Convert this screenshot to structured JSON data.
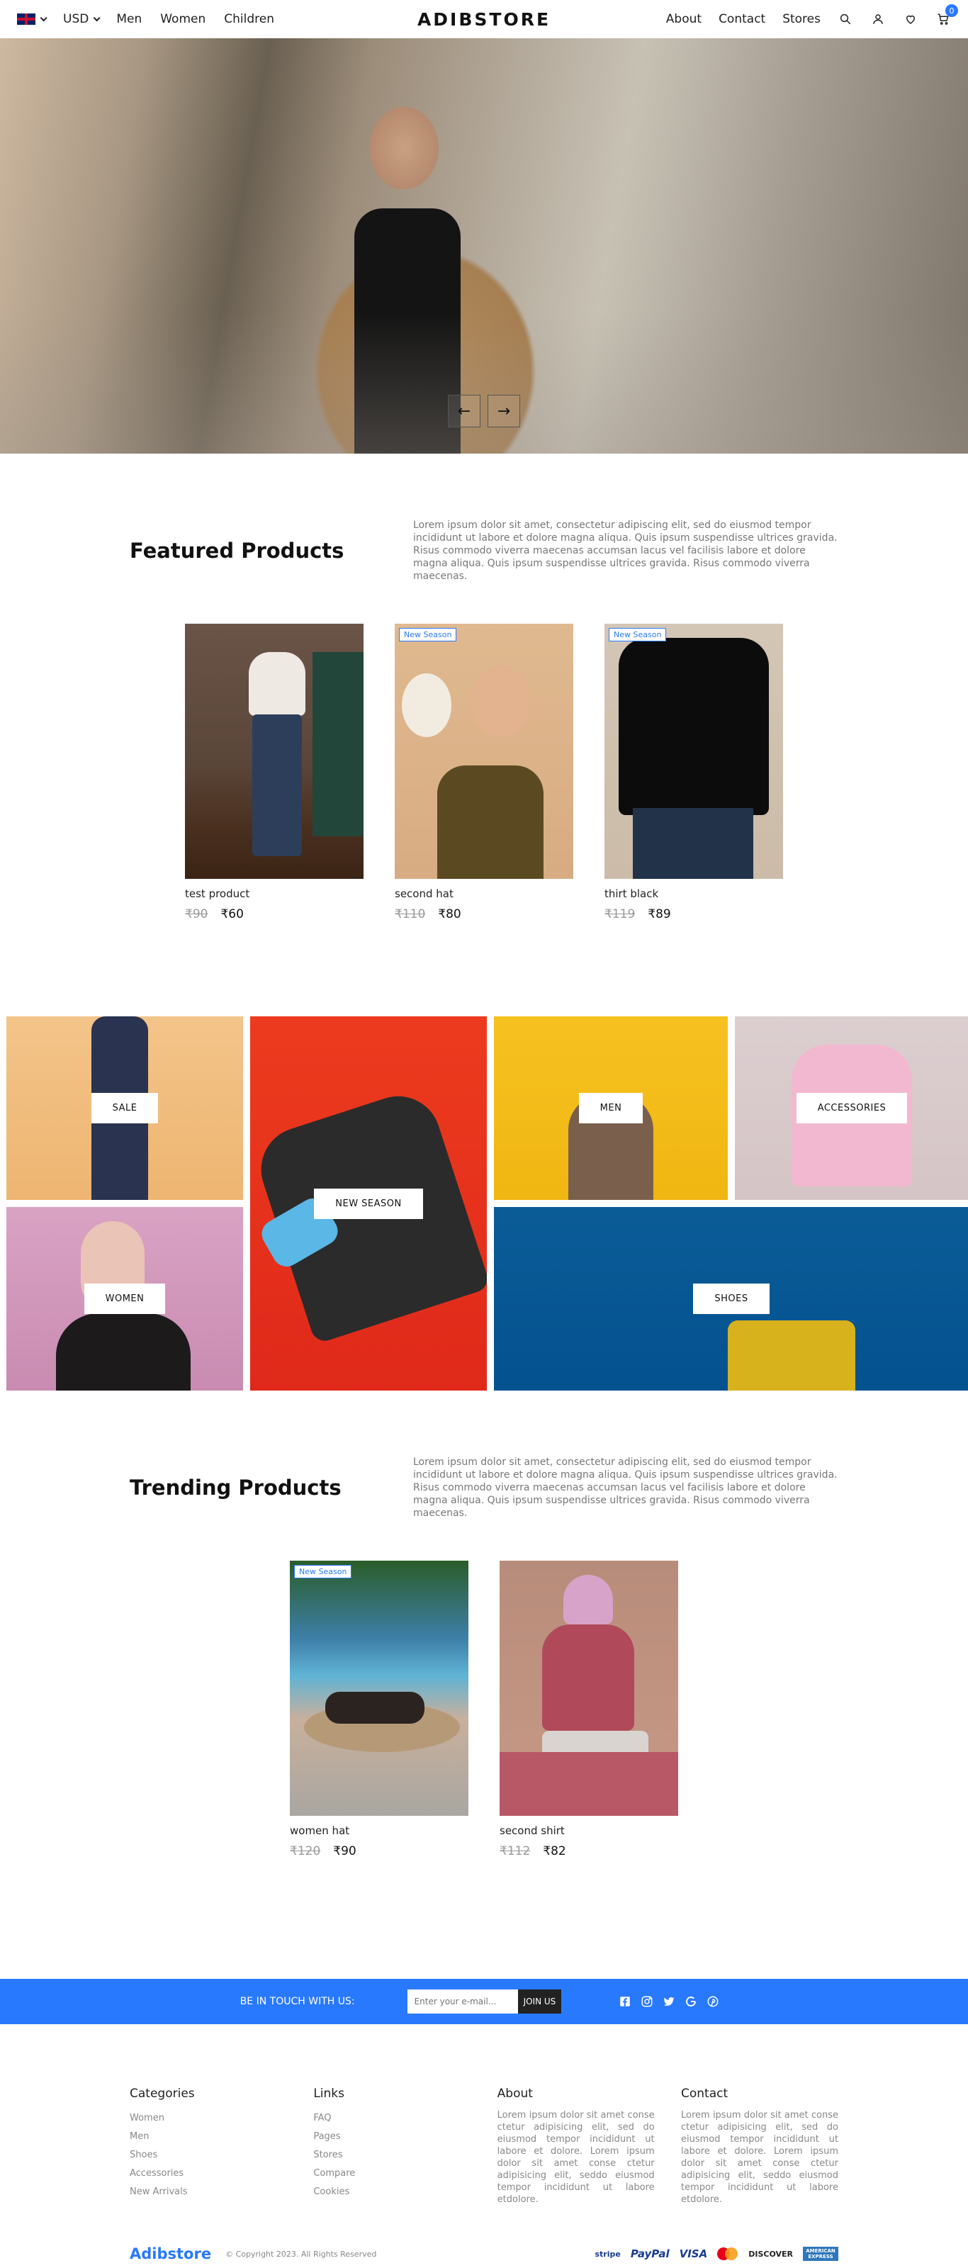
{
  "nav": {
    "currency": "USD",
    "left_links": [
      "Men",
      "Women",
      "Children"
    ],
    "logo": "ADIBSTORE",
    "right_links": [
      "About",
      "Contact",
      "Stores"
    ],
    "cart_count": "0"
  },
  "hero": {
    "prev_arrow": "←",
    "next_arrow": "→"
  },
  "featured": {
    "title": "Featured Products",
    "description": "Lorem ipsum dolor sit amet, consectetur adipiscing elit, sed do eiusmod tempor incididunt ut labore et dolore magna aliqua. Quis ipsum suspendisse ultrices gravida. Risus commodo viverra maecenas accumsan lacus vel facilisis labore et dolore magna aliqua. Quis ipsum suspendisse ultrices gravida. Risus commodo viverra maecenas.",
    "products": [
      {
        "name": "test product",
        "old_price": "₹90",
        "price": "₹60",
        "badge": ""
      },
      {
        "name": "second hat",
        "old_price": "₹110",
        "price": "₹80",
        "badge": "New Season"
      },
      {
        "name": "thirt black",
        "old_price": "₹119",
        "price": "₹89",
        "badge": "New Season"
      }
    ]
  },
  "categories": {
    "sale": "SALE",
    "new_season": "NEW SEASON",
    "men": "MEN",
    "accessories": "ACCESSORIES",
    "women": "WOMEN",
    "shoes": "SHOES"
  },
  "trending": {
    "title": "Trending Products",
    "description": "Lorem ipsum dolor sit amet, consectetur adipiscing elit, sed do eiusmod tempor incididunt ut labore et dolore magna aliqua. Quis ipsum suspendisse ultrices gravida. Risus commodo viverra maecenas accumsan lacus vel facilisis labore et dolore magna aliqua. Quis ipsum suspendisse ultrices gravida. Risus commodo viverra maecenas.",
    "products": [
      {
        "name": "women hat",
        "old_price": "₹120",
        "price": "₹90",
        "badge": "New Season"
      },
      {
        "name": "second shirt",
        "old_price": "₹112",
        "price": "₹82",
        "badge": ""
      }
    ]
  },
  "newsletter": {
    "label": "BE IN TOUCH WITH US:",
    "placeholder": "Enter your e-mail...",
    "button": "JOIN US"
  },
  "footer": {
    "categories_title": "Categories",
    "categories": [
      "Women",
      "Men",
      "Shoes",
      "Accessories",
      "New Arrivals"
    ],
    "links_title": "Links",
    "links": [
      "FAQ",
      "Pages",
      "Stores",
      "Compare",
      "Cookies"
    ],
    "about_title": "About",
    "about_text": "Lorem ipsum dolor sit amet conse ctetur adipisicing elit, sed do eiusmod tempor incididunt ut labore et dolore. Lorem ipsum dolor sit amet conse ctetur adipisicing elit, seddo eiusmod tempor incididunt ut labore etdolore.",
    "contact_title": "Contact",
    "contact_text": "Lorem ipsum dolor sit amet conse ctetur adipisicing elit, sed do eiusmod tempor incididunt ut labore et dolore. Lorem ipsum dolor sit amet conse ctetur adipisicing elit, seddo eiusmod tempor incididunt ut labore etdolore.",
    "brand": "Adibstore",
    "copyright": "© Copyright 2023. All Rights Reserved",
    "payments": [
      "stripe",
      "PayPal",
      "VISA",
      "DISCOVER",
      "AMERICAN EXPRESS"
    ]
  },
  "colors": {
    "accent": "#2879fe",
    "text": "#222222",
    "muted": "#888888"
  }
}
